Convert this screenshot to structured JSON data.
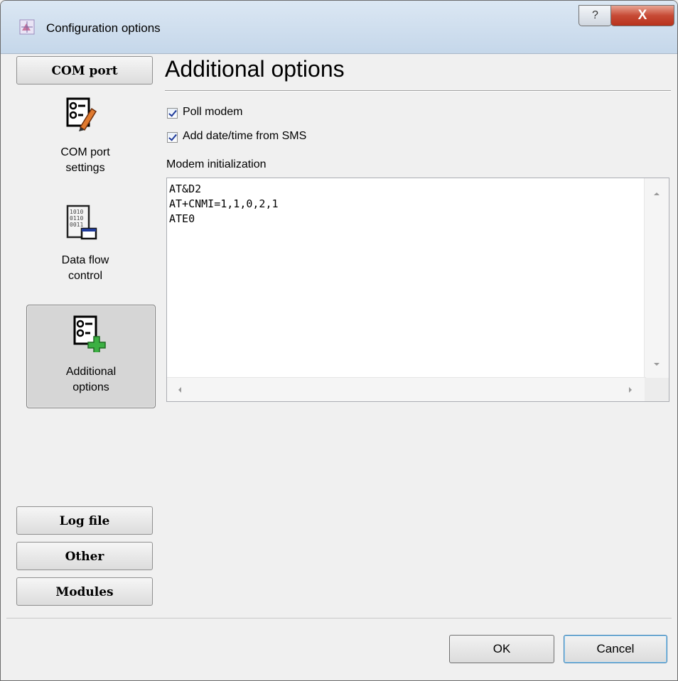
{
  "window": {
    "title": "Configuration options",
    "help_label": "?",
    "close_label": "X"
  },
  "nav": {
    "com_port_label": "COM port",
    "items": [
      {
        "label": "COM port\nsettings",
        "icon": "settings-edit-icon"
      },
      {
        "label": "Data flow\ncontrol",
        "icon": "binary-data-icon"
      },
      {
        "label": "Additional\noptions",
        "icon": "settings-add-icon",
        "selected": true
      }
    ],
    "log_file_label": "Log file",
    "other_label": "Other",
    "modules_label": "Modules"
  },
  "main": {
    "heading": "Additional options",
    "checkboxes": [
      {
        "label": "Poll modem",
        "checked": true
      },
      {
        "label": "Add date/time from SMS",
        "checked": true
      }
    ],
    "init_label": "Modem initialization",
    "init_text": "AT&D2\nAT+CNMI=1,1,0,2,1\nATE0"
  },
  "buttons": {
    "ok_label": "OK",
    "cancel_label": "Cancel"
  },
  "colors": {
    "accent": "#1f3b9a",
    "plus_green": "#3cb043",
    "close_red": "#c74a35"
  }
}
